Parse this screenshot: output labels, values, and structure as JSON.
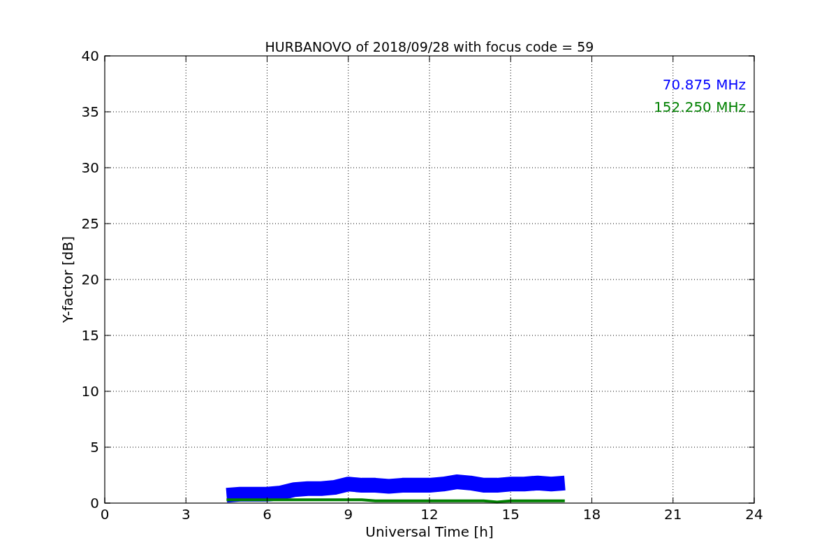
{
  "chart_data": {
    "type": "line",
    "title": "HURBANOVO of 2018/09/28 with focus code = 59",
    "xlabel": "Universal Time [h]",
    "ylabel": "Y-factor [dB]",
    "x": [
      4.5,
      5,
      5.5,
      6,
      6.5,
      7,
      7.5,
      8,
      8.5,
      9,
      9.5,
      10,
      10.5,
      11,
      11.5,
      12,
      12.5,
      13,
      13.5,
      14,
      14.5,
      15,
      15.5,
      16,
      16.5,
      17
    ],
    "series": [
      {
        "name": "70.875 MHz",
        "color": "#0000ff",
        "values": [
          0.7,
          0.8,
          0.8,
          0.8,
          0.9,
          1.2,
          1.3,
          1.3,
          1.4,
          1.7,
          1.6,
          1.6,
          1.5,
          1.6,
          1.6,
          1.6,
          1.7,
          1.9,
          1.8,
          1.6,
          1.6,
          1.7,
          1.7,
          1.8,
          1.7,
          1.8
        ]
      },
      {
        "name": "152.250 MHz",
        "color": "#008000",
        "values": [
          0.3,
          0.3,
          0.3,
          0.3,
          0.3,
          0.3,
          0.3,
          0.3,
          0.3,
          0.3,
          0.3,
          0.2,
          0.2,
          0.2,
          0.2,
          0.2,
          0.2,
          0.2,
          0.2,
          0.2,
          0.1,
          0.2,
          0.2,
          0.2,
          0.2,
          0.2
        ]
      }
    ],
    "xlim": [
      0,
      24
    ],
    "ylim": [
      0,
      40
    ],
    "xticks": [
      0,
      3,
      6,
      9,
      12,
      15,
      18,
      21,
      24
    ],
    "yticks": [
      0,
      5,
      10,
      15,
      20,
      25,
      30,
      35,
      40
    ],
    "grid": true
  }
}
